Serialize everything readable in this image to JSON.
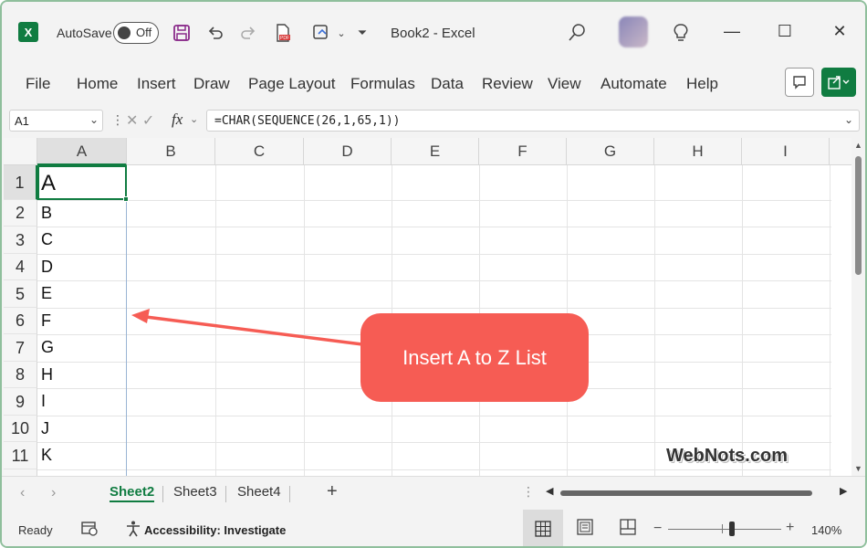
{
  "titlebar": {
    "app_icon": "X",
    "autosave_label": "AutoSave",
    "autosave_state": "Off",
    "title": "Book2  -  Excel",
    "icons": [
      "save-icon",
      "undo-icon",
      "redo-icon",
      "pdf-icon",
      "touch-mode-icon",
      "customize-icon",
      "search-icon",
      "lightbulb-icon"
    ]
  },
  "ribbon": {
    "tabs": [
      "File",
      "Home",
      "Insert",
      "Draw",
      "Page Layout",
      "Formulas",
      "Data",
      "Review",
      "View",
      "Automate",
      "Help"
    ]
  },
  "formula_bar": {
    "name_box": "A1",
    "fx": "fx",
    "formula": "=CHAR(SEQUENCE(26,1,65,1))"
  },
  "grid": {
    "columns": [
      "A",
      "B",
      "C",
      "D",
      "E",
      "F",
      "G",
      "H",
      "I"
    ],
    "rows": [
      "1",
      "2",
      "3",
      "4",
      "5",
      "6",
      "7",
      "8",
      "9",
      "10",
      "11"
    ],
    "column_a_values": [
      "A",
      "B",
      "C",
      "D",
      "E",
      "F",
      "G",
      "H",
      "I",
      "J",
      "K"
    ],
    "active_cell": "A1"
  },
  "callout": {
    "text": "Insert A to Z List",
    "color": "#f65c54"
  },
  "watermark": "WebNots.com",
  "sheets": {
    "tabs": [
      "Sheet2",
      "Sheet3",
      "Sheet4"
    ],
    "active": "Sheet2",
    "add": "+",
    "more": "⋮"
  },
  "statusbar": {
    "ready": "Ready",
    "accessibility": "Accessibility: Investigate",
    "zoom_minus": "−",
    "zoom_plus": "+",
    "zoom": "140%"
  },
  "colors": {
    "accent": "#107c41",
    "callout": "#f65c54"
  }
}
